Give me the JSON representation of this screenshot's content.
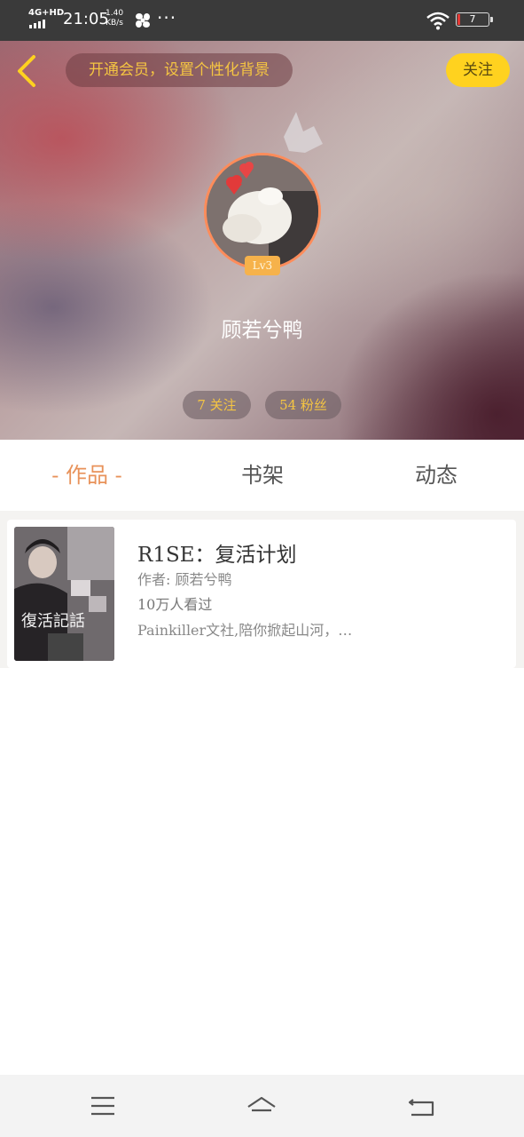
{
  "status_bar": {
    "network": "4G+HD",
    "time": "21:05",
    "speed_value": "1.40",
    "speed_unit": "KB/s",
    "more": "···",
    "battery": "7",
    "icons": [
      "signal-icon",
      "fan-icon",
      "wifi-icon",
      "battery-icon"
    ]
  },
  "header": {
    "back_icon": "chevron-left-icon",
    "vip_banner": "开通会员，设置个性化背景",
    "follow_label": "关注",
    "level": "Lv3",
    "username": "顾若兮鸭",
    "following": "7 关注",
    "followers": "54 粉丝"
  },
  "tabs": [
    {
      "label": "- 作品 -",
      "active": true
    },
    {
      "label": "书架",
      "active": false
    },
    {
      "label": "动态",
      "active": false
    }
  ],
  "works": [
    {
      "title": "R1SE：复活计划",
      "author": "作者: 顾若兮鸭",
      "views": "10万人看过",
      "description": "Painkiller文社,陪你掀起山河，…",
      "cover_text": "復活記話"
    }
  ],
  "nav_bar": {
    "icons": [
      "menu-icon",
      "home-icon",
      "back-icon"
    ]
  },
  "colors": {
    "accent_orange": "#e8925a",
    "vip_text": "#f5c542",
    "follow_button": "#ffd21f",
    "avatar_border": "#ff8c5a",
    "level_badge": "#f6b24b"
  }
}
